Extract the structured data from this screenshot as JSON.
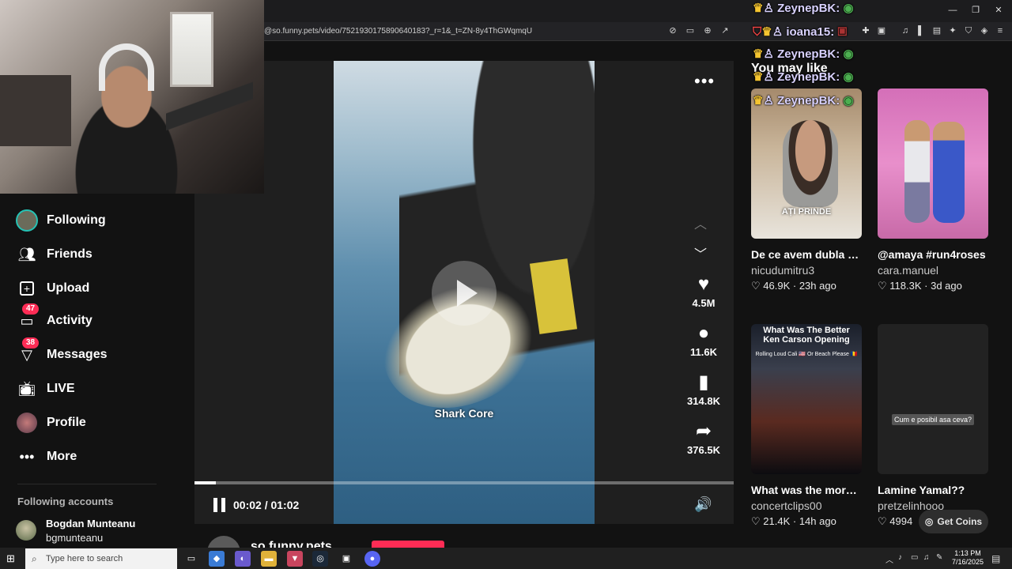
{
  "browser": {
    "url": "@so.funny.pets/video/7521930175890640183?_r=1&_t=ZN-8y4ThGWqmqU"
  },
  "sidebar": {
    "items": [
      {
        "label": "Following",
        "icon": "following-avatar-icon"
      },
      {
        "label": "Friends",
        "icon": "friends-icon"
      },
      {
        "label": "Upload",
        "icon": "upload-icon"
      },
      {
        "label": "Activity",
        "icon": "activity-icon",
        "badge": "47"
      },
      {
        "label": "Messages",
        "icon": "messages-icon",
        "badge": "38"
      },
      {
        "label": "LIVE",
        "icon": "live-icon"
      },
      {
        "label": "Profile",
        "icon": "profile-avatar-icon"
      },
      {
        "label": "More",
        "icon": "more-dots-icon"
      }
    ],
    "following_accounts_title": "Following accounts",
    "following_accounts": [
      {
        "name": "Bogdan Munteanu",
        "handle": "bgmunteanu"
      }
    ]
  },
  "video": {
    "caption": "Shark Core",
    "likes": "4.5M",
    "comments": "11.6K",
    "saves": "314.8K",
    "shares": "376.5K",
    "time": "00:02 / 01:02",
    "progress": 0.04,
    "author": "so.funny.pets"
  },
  "recommendations": {
    "title": "You may like",
    "cards": [
      {
        "title": "De ce avem dubla măsură când vine...",
        "author": "nicudumitru3",
        "likes": "46.9K",
        "age": "23h ago",
        "thumb_text": "AȚI PRINDE"
      },
      {
        "title": "@amaya #run4roses",
        "author": "cara.manuel",
        "likes": "118.3K",
        "age": "3d ago",
        "thumb_text": ""
      },
      {
        "title": "What was the more lit opening for Ken...",
        "author": "concertclips00",
        "likes": "21.4K",
        "age": "14h ago",
        "thumb_text": "What Was The Better Ken Carson Opening",
        "thumb_sub": "Rolling Loud Cali 🇺🇸 Or Beach Please 🇷🇴"
      },
      {
        "title": "Lamine Yamal??",
        "author": "pretzelinhooo",
        "likes": "4994",
        "age": "",
        "thumb_text": "Cum e posibil asa ceva?"
      }
    ]
  },
  "get_coins": "Get Coins",
  "chat": [
    {
      "user": "ZeynepBK:"
    },
    {
      "user": "ioana15:"
    },
    {
      "user": "ZeynepBK:"
    },
    {
      "user": "ZeynepBK:"
    },
    {
      "user": "ZeynepBK:"
    }
  ],
  "taskbar": {
    "search_placeholder": "Type here to search",
    "time": "1:13 PM",
    "date": "7/16/2025"
  },
  "colors": {
    "accent": "#fe2c55",
    "background": "#121212"
  }
}
